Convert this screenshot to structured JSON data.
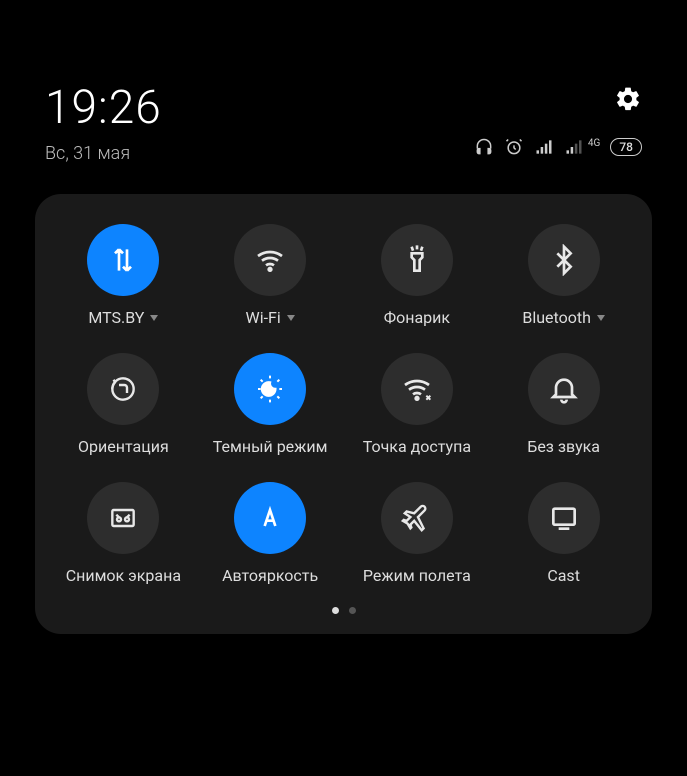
{
  "header": {
    "time": "19:26",
    "date": "Вс, 31 мая",
    "battery": "78",
    "network_label": "4G"
  },
  "toggles": [
    {
      "id": "mobile-data",
      "label": "MTS.BY",
      "active": true,
      "expandable": true
    },
    {
      "id": "wifi",
      "label": "Wi-Fi",
      "active": false,
      "expandable": true
    },
    {
      "id": "flashlight",
      "label": "Фонарик",
      "active": false,
      "expandable": false
    },
    {
      "id": "bluetooth",
      "label": "Bluetooth",
      "active": false,
      "expandable": true
    },
    {
      "id": "orientation",
      "label": "Ориентация",
      "active": false,
      "expandable": false
    },
    {
      "id": "dark-mode",
      "label": "Темный режим",
      "active": true,
      "expandable": false
    },
    {
      "id": "hotspot",
      "label": "Точка доступа",
      "active": false,
      "expandable": false
    },
    {
      "id": "silent",
      "label": "Без звука",
      "active": false,
      "expandable": false
    },
    {
      "id": "screenshot",
      "label": "Снимок экрана",
      "active": false,
      "expandable": false
    },
    {
      "id": "auto-brightness",
      "label": "Автояркость",
      "active": true,
      "expandable": false
    },
    {
      "id": "airplane",
      "label": "Режим полета",
      "active": false,
      "expandable": false
    },
    {
      "id": "cast",
      "label": "Cast",
      "active": false,
      "expandable": false
    }
  ],
  "pagination": {
    "pages": 2,
    "current": 0
  }
}
